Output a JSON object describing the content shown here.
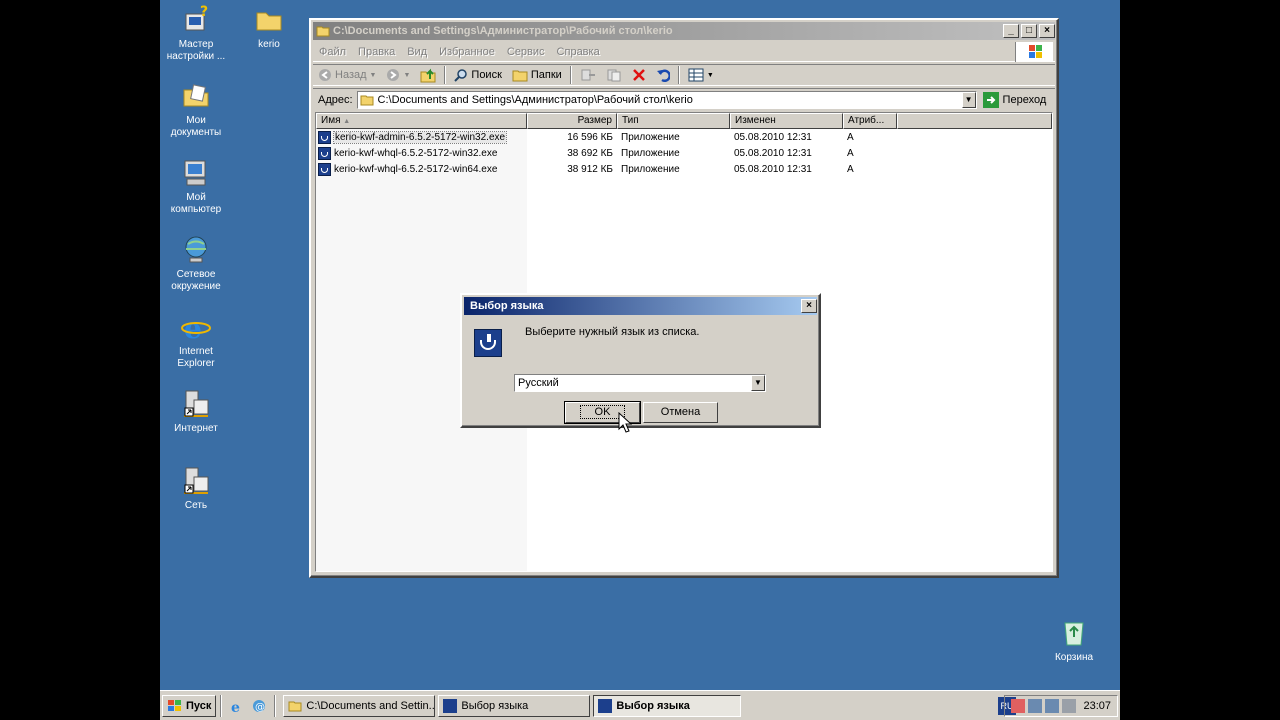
{
  "desktop": {
    "icons": [
      {
        "id": "wizard",
        "label_line1": "Мастер",
        "label_line2": "настройки ...",
        "icon": "wizard-icon"
      },
      {
        "id": "kerio-folder",
        "label_line1": "kerio",
        "label_line2": "",
        "icon": "folder-icon"
      },
      {
        "id": "my-documents",
        "label_line1": "Мои",
        "label_line2": "документы",
        "icon": "my-documents-icon"
      },
      {
        "id": "my-computer",
        "label_line1": "Мой",
        "label_line2": "компьютер",
        "icon": "my-computer-icon"
      },
      {
        "id": "network-places",
        "label_line1": "Сетевое",
        "label_line2": "окружение",
        "icon": "network-places-icon"
      },
      {
        "id": "internet-explorer",
        "label_line1": "Internet",
        "label_line2": "Explorer",
        "icon": "internet-explorer-icon"
      },
      {
        "id": "internet",
        "label_line1": "Интернет",
        "label_line2": "",
        "icon": "network-shortcut-icon"
      },
      {
        "id": "network",
        "label_line1": "Сеть",
        "label_line2": "",
        "icon": "network-shortcut-icon"
      },
      {
        "id": "recycle-bin",
        "label_line1": "Корзина",
        "label_line2": "",
        "icon": "recycle-bin-icon"
      }
    ]
  },
  "explorer": {
    "title": "C:\\Documents and Settings\\Администратор\\Рабочий стол\\kerio",
    "menu": [
      "Файл",
      "Правка",
      "Вид",
      "Избранное",
      "Сервис",
      "Справка"
    ],
    "toolbar": {
      "back": "Назад",
      "search": "Поиск",
      "folders": "Папки"
    },
    "address": {
      "label": "Адрес:",
      "value": "C:\\Documents and Settings\\Администратор\\Рабочий стол\\kerio",
      "go": "Переход"
    },
    "columns": [
      "Имя",
      "Размер",
      "Тип",
      "Изменен",
      "Атриб..."
    ],
    "rows": [
      {
        "name": "kerio-kwf-admin-6.5.2-5172-win32.exe",
        "size": "16 596 КБ",
        "type": "Приложение",
        "modified": "05.08.2010 12:31",
        "attr": "A"
      },
      {
        "name": "kerio-kwf-whql-6.5.2-5172-win32.exe",
        "size": "38 692 КБ",
        "type": "Приложение",
        "modified": "05.08.2010 12:31",
        "attr": "A"
      },
      {
        "name": "kerio-kwf-whql-6.5.2-5172-win64.exe",
        "size": "38 912 КБ",
        "type": "Приложение",
        "modified": "05.08.2010 12:31",
        "attr": "A"
      }
    ]
  },
  "dialog": {
    "title": "Выбор языка",
    "message": "Выберите нужный язык из списка.",
    "selected_language": "Русский",
    "ok": "OK",
    "cancel": "Отмена"
  },
  "taskbar": {
    "start": "Пуск",
    "tasks": [
      {
        "label": "C:\\Documents and Settin...",
        "active": false
      },
      {
        "label": "Выбор языка",
        "active": false
      },
      {
        "label": "Выбор языка",
        "active": true
      }
    ],
    "lang": "RU",
    "clock": "23:07"
  },
  "colors": {
    "desktop": "#3a6ea5",
    "active_title": "#0a246a",
    "inactive_title": "#808080"
  }
}
